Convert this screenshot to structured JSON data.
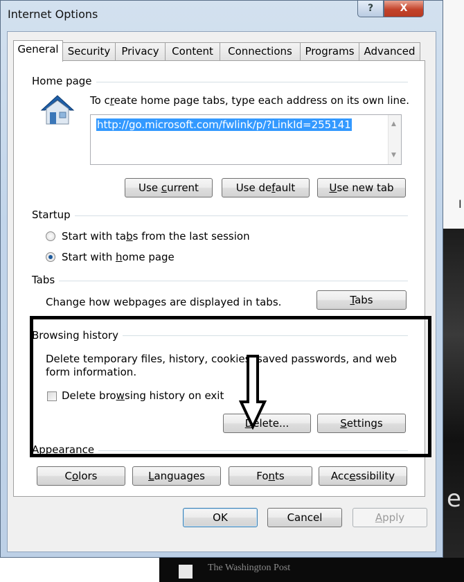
{
  "window": {
    "title": "Internet Options",
    "help_label": "?",
    "close_label": "X"
  },
  "tabs": [
    "General",
    "Security",
    "Privacy",
    "Content",
    "Connections",
    "Programs",
    "Advanced"
  ],
  "home_page": {
    "group_label": "Home page",
    "instruction_pre": "To c",
    "instruction_u": "r",
    "instruction_post": "eate home page tabs, type each address on its own line.",
    "url": "http://go.microsoft.com/fwlink/p/?LinkId=255141",
    "use_current": {
      "pre": "Use ",
      "u": "c",
      "post": "urrent"
    },
    "use_default": {
      "pre": "Use de",
      "u": "f",
      "post": "ault"
    },
    "use_new_tab": {
      "pre": "",
      "u": "U",
      "post": "se new tab"
    }
  },
  "startup": {
    "group_label": "Startup",
    "option1": {
      "pre": "Start with ta",
      "u": "b",
      "post": "s from the last session",
      "selected": false
    },
    "option2": {
      "pre": "Start with ",
      "u": "h",
      "post": "ome page",
      "selected": true
    }
  },
  "tabs_section": {
    "group_label": "Tabs",
    "description": "Change how webpages are displayed in tabs.",
    "button": {
      "pre": "",
      "u": "T",
      "post": "abs"
    }
  },
  "browsing_history": {
    "group_label": "Browsing history",
    "description_line1": "Delete temporary files, history, cookies, saved passwords, and web",
    "description_line2": "form information.",
    "checkbox": {
      "pre": "Delete bro",
      "u": "w",
      "post": "sing history on exit",
      "checked": false
    },
    "delete_button": {
      "pre": "",
      "u": "D",
      "post": "elete..."
    },
    "settings_button": {
      "pre": "",
      "u": "S",
      "post": "ettings"
    }
  },
  "appearance": {
    "group_label": "Appearance",
    "colors": {
      "pre": "C",
      "u": "o",
      "post": "lors"
    },
    "languages": {
      "pre": "",
      "u": "L",
      "post": "anguages"
    },
    "fonts": {
      "pre": "Fo",
      "u": "n",
      "post": "ts"
    },
    "accessibility": {
      "pre": "Acc",
      "u": "e",
      "post": "ssibility"
    }
  },
  "footer": {
    "ok": "OK",
    "cancel": "Cancel",
    "apply": {
      "pre": "",
      "u": "A",
      "post": "pply"
    }
  },
  "background": {
    "letter1": "I",
    "letter2": "e",
    "caption": "The Washington Post"
  },
  "colors": {
    "accent": "#3399ff",
    "highlight_box": "#000000",
    "close_button": "#c3432b"
  }
}
